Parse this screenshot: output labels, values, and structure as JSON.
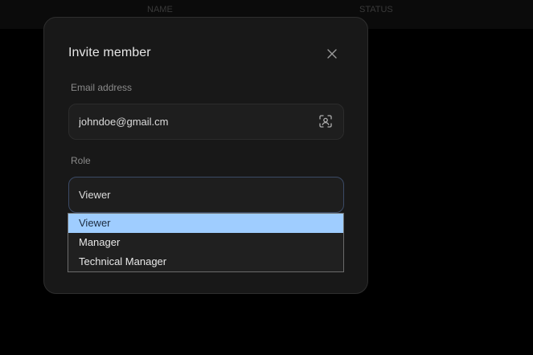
{
  "background": {
    "columns": [
      "NAME",
      "STATUS"
    ]
  },
  "modal": {
    "title": "Invite member",
    "close_icon": "close-icon"
  },
  "email": {
    "label": "Email address",
    "value": "johndoe@gmail.cm",
    "icon": "contact-scan-icon"
  },
  "role": {
    "label": "Role",
    "value": "Viewer",
    "options": [
      "Viewer",
      "Manager",
      "Technical Manager"
    ],
    "selected_index": 0
  },
  "colors": {
    "modal_bg": "#181818",
    "selected_option_bg": "#9fcdff",
    "focus_border": "#3b4a66"
  }
}
